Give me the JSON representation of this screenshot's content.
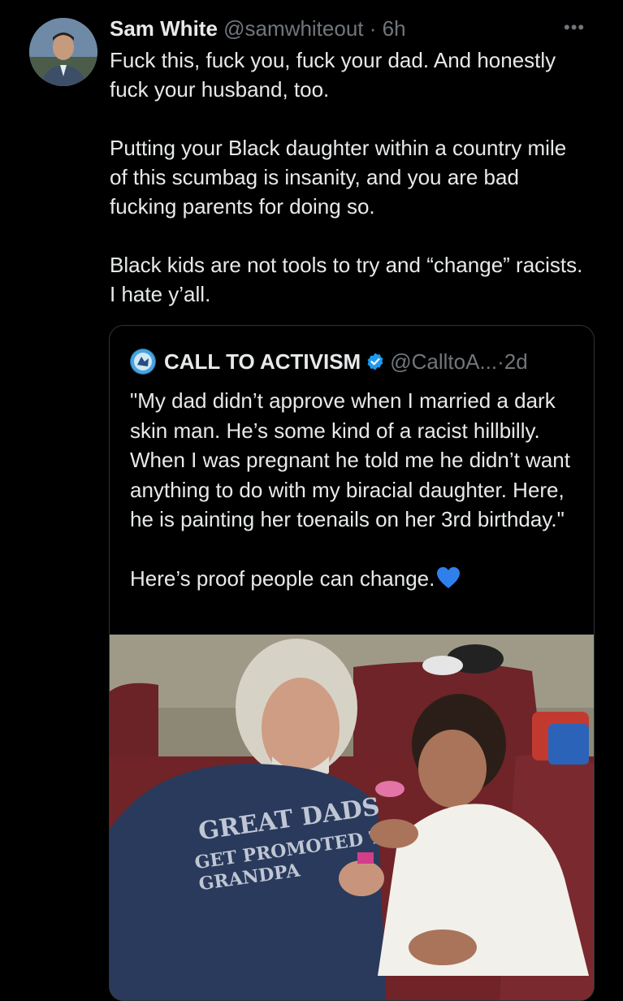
{
  "tweet": {
    "author_name": "Sam White",
    "author_handle": "@samwhiteout",
    "separator": "·",
    "time": "6h",
    "paragraphs": [
      "Fuck this, fuck you, fuck your dad. And honestly fuck your husband, too.",
      "Putting your Black daughter within a country mile of this scumbag is insanity, and you are bad fucking parents for doing so.",
      "Black kids are not tools to try and “change” racists. I hate y’all."
    ],
    "more_icon": "more-horizontal-icon"
  },
  "quote": {
    "author_name": "CALL TO ACTIVISM",
    "author_handle": "@CalltoA...",
    "separator": "·",
    "time": "2d",
    "verified_icon": "verified-badge-icon",
    "paragraph_1": "\"My dad didn’t approve when I married a dark skin man. He’s some kind of a racist hillbilly. When I was pregnant he told me he didn’t want anything to do with my biracial daughter. Here, he is painting her toenails on her 3rd birthday.\"",
    "paragraph_2": "Here’s proof people can change.",
    "emoji": "blue-heart-emoji",
    "media": {
      "shirt_text_line_1": "GREAT DADS",
      "shirt_text_line_2": "GET PROMOTED TO",
      "shirt_text_line_3": "GRANDPA"
    }
  },
  "colors": {
    "background": "#000000",
    "primary_text": "#e7e9ea",
    "secondary_text": "#71767b",
    "border": "#2f3336",
    "verified_blue": "#1d9bf0"
  }
}
